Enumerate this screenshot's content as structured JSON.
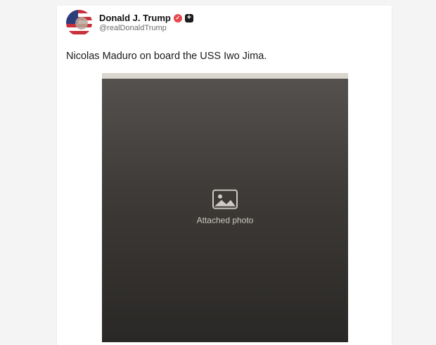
{
  "post": {
    "author": {
      "display_name": "Donald J. Trump",
      "handle": "@realDonaldTrump",
      "verified_icon": "verified-badge-icon",
      "follow_icon": "plus-icon"
    },
    "text": "Nicolas Maduro on board the USS Iwo Jima.",
    "media": {
      "type": "photo",
      "placeholder_label": "Attached photo"
    }
  },
  "colors": {
    "verified_badge": "#e5484d",
    "follow_button": "#1a1a1a",
    "handle_text": "#6b6b6b"
  }
}
